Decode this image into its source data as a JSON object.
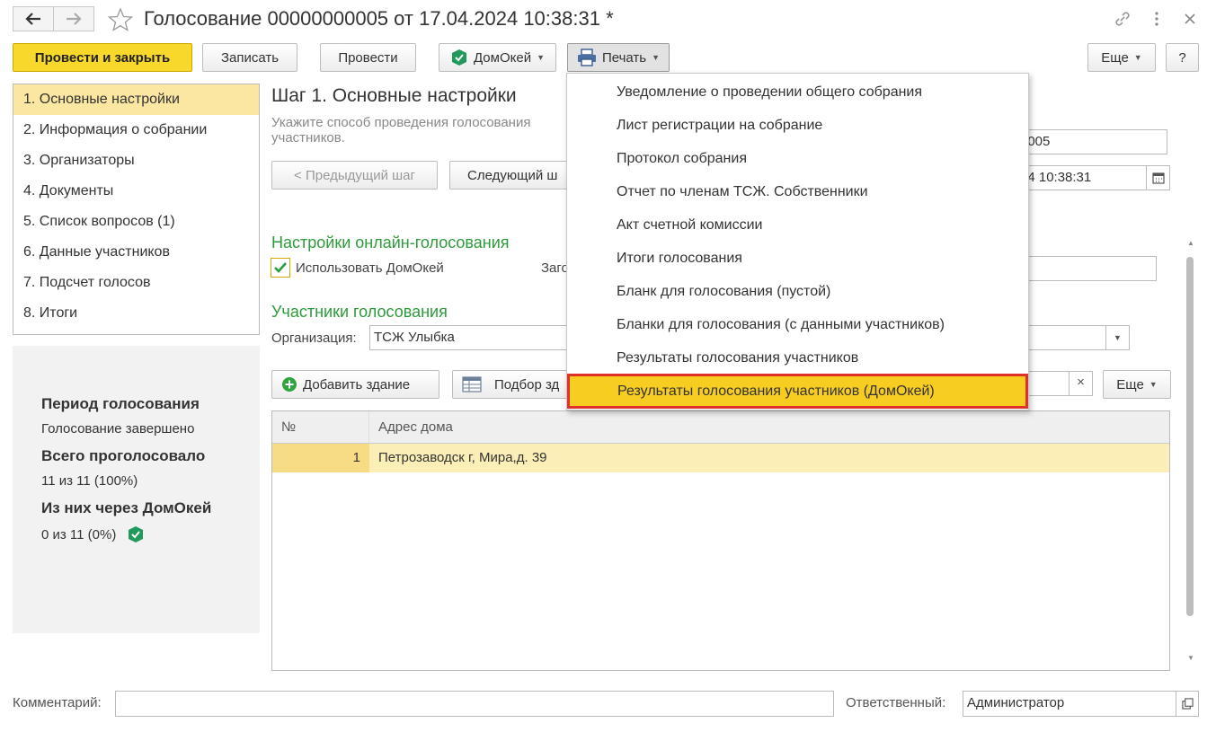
{
  "window": {
    "title": "Голосование 00000000005 от 17.04.2024 10:38:31 *"
  },
  "toolbar": {
    "post_close": "Провести и закрыть",
    "save": "Записать",
    "post": "Провести",
    "domokey": "ДомОкей",
    "print": "Печать",
    "more": "Еще",
    "help": "?"
  },
  "steps": [
    "1. Основные настройки",
    "2. Информация о собрании",
    "3. Организаторы",
    "4. Документы",
    "5. Список вопросов (1)",
    "6. Данные участников",
    "7. Подсчет голосов",
    "8. Итоги"
  ],
  "summary": {
    "period_title": "Период голосования",
    "period_value": "Голосование завершено",
    "total_title": "Всего проголосовало",
    "total_value": "11 из 11 (100%)",
    "via_title": "Из них через ДомОкей",
    "via_value": "0 из 11 (0%)"
  },
  "main": {
    "step_title": "Шаг 1. Основные настройки",
    "note_line1": "Укажите способ проведения голосования ",
    "note_line2": "участников.",
    "prev_step": "< Предыдущий шаг",
    "next_step": "Следующий ш",
    "number_value": "0005",
    "date_value": "24 10:38:31",
    "online_title": "Настройки онлайн-голосования",
    "use_domokey": "Использовать ДомОкей",
    "zago_label": "Заго",
    "participants_title": "Участники голосования",
    "org_label": "Организация:",
    "org_value": "ТСЖ Улыбка",
    "add_building": "Добавить здание",
    "pick_building": "Подбор зд",
    "clear_x": "×",
    "table_more": "Еще"
  },
  "table": {
    "headers": [
      "№",
      "Адрес дома"
    ],
    "rows": [
      {
        "num": "1",
        "address": "Петрозаводск г, Мира,д. 39"
      }
    ]
  },
  "print_menu": [
    "Уведомление о проведении общего собрания",
    "Лист регистрации на собрание",
    "Протокол собрания",
    "Отчет по членам ТСЖ. Собственники",
    "Акт счетной комиссии",
    "Итоги голосования",
    "Бланк для голосования (пустой)",
    "Бланки для голосования (с данными участников)",
    "Результаты голосования участников",
    "Результаты голосования участников (ДомОкей)"
  ],
  "footer": {
    "comment_label": "Комментарий:",
    "comment_value": "",
    "responsible_label": "Ответственный:",
    "responsible_value": "Администратор"
  },
  "colors": {
    "primary_button": "#f8d82a",
    "active_step": "#fbe7a2",
    "section_title": "#2c9b3a",
    "menu_highlight": "#f8cd22",
    "highlight_border": "#e0302a",
    "domokey_badge": "#1f9a5c"
  }
}
